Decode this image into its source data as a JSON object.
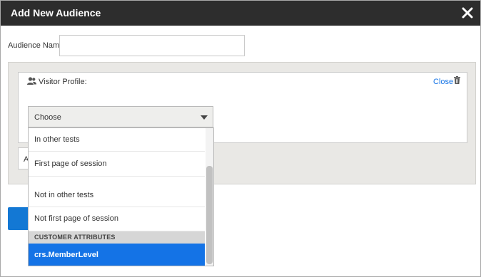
{
  "dialog": {
    "title": "Add New Audience",
    "close_icon": "close-x-icon"
  },
  "audience_name": {
    "label": "Audience Name",
    "value": "",
    "placeholder": ""
  },
  "rule_card": {
    "icon": "users-icon",
    "label": "Visitor Profile:",
    "close_label": "Close",
    "delete_icon": "trash-icon"
  },
  "and_button": {
    "label": "A"
  },
  "select": {
    "value": "Choose",
    "caret_icon": "caret-down-icon",
    "options": [
      "In other tests",
      "First page of session",
      "Not in other tests",
      "Not first page of session"
    ],
    "group_header": "CUSTOMER ATTRIBUTES",
    "selected_option": "crs.MemberLevel"
  },
  "colors": {
    "titlebar": "#2d2d2d",
    "accent": "#1473e6",
    "panel": "#e9e8e5"
  }
}
